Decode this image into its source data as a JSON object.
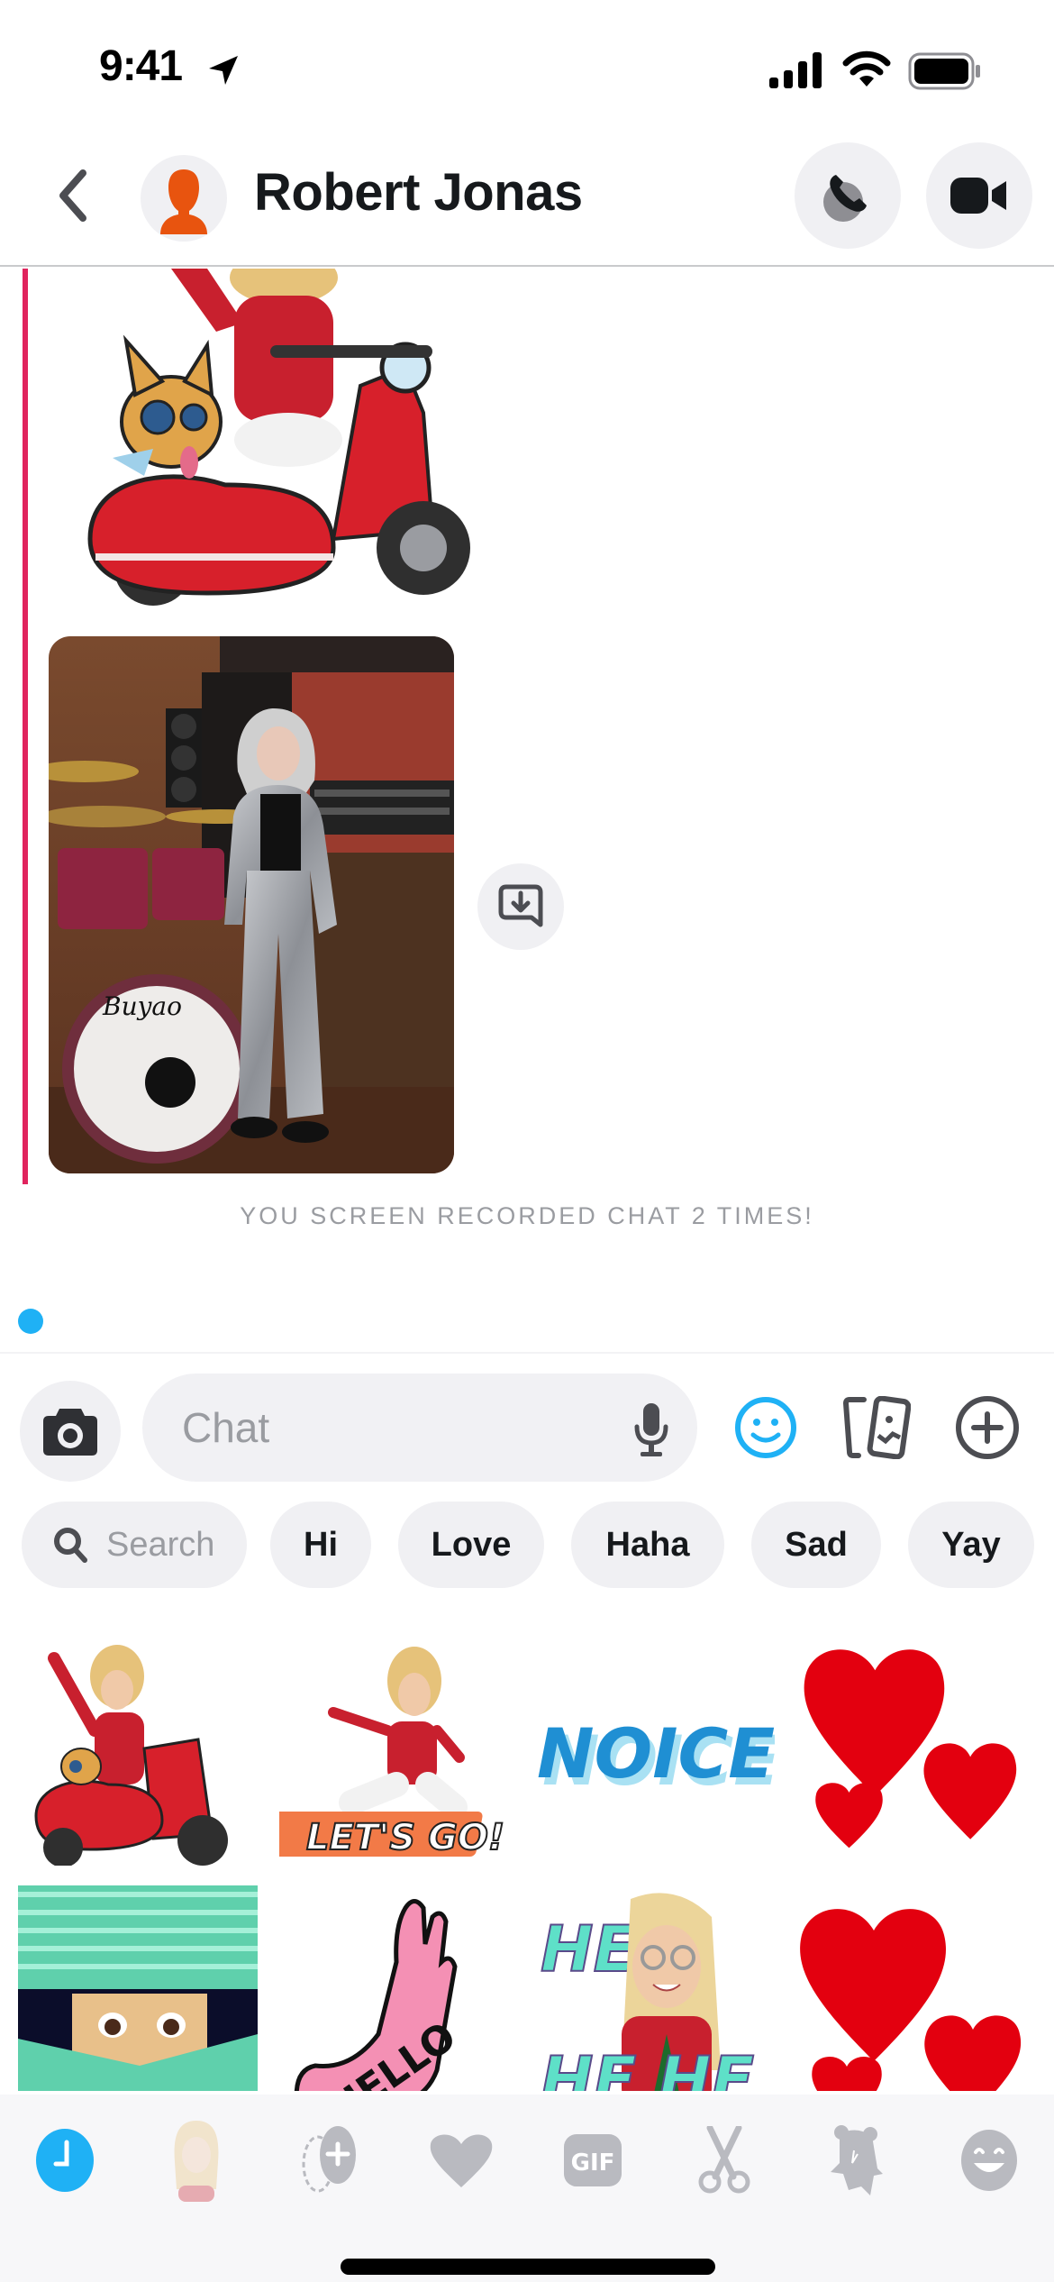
{
  "status_bar": {
    "time": "9:41"
  },
  "header": {
    "contact_name": "Robert Jonas",
    "back_label": "Back",
    "call_label": "Call",
    "video_label": "Video call"
  },
  "chat": {
    "messages": [
      {
        "type": "sticker",
        "description": "Bitmoji on red scooter with corgi in sidecar"
      },
      {
        "type": "photo",
        "description": "Woman in silver tracksuit standing by drum kit in recording studio"
      }
    ],
    "save_label": "Save in chat",
    "system_message": "YOU SCREEN RECORDED CHAT 2 TIMES!"
  },
  "input_bar": {
    "placeholder": "Chat",
    "value": ""
  },
  "chips": {
    "search_placeholder": "Search",
    "items": [
      "Hi",
      "Love",
      "Haha",
      "Sad",
      "Yay"
    ]
  },
  "stickers": [
    {
      "name": "scooter-bitmoji",
      "label": ""
    },
    {
      "name": "lets-go-bitmoji",
      "label": "LET'S GO!"
    },
    {
      "name": "noice",
      "label": "NOICE"
    },
    {
      "name": "hearts",
      "label": ""
    },
    {
      "name": "peeking-bitmoji",
      "label": ""
    },
    {
      "name": "hello-hand",
      "label": "HELLO"
    },
    {
      "name": "hehe-bitmoji",
      "label": "HE HE"
    },
    {
      "name": "hearts-2",
      "label": ""
    }
  ],
  "tab_bar": {
    "tabs": [
      {
        "name": "recent",
        "label": "Recent",
        "active": true
      },
      {
        "name": "bitmoji",
        "label": "Bitmoji",
        "active": false
      },
      {
        "name": "create",
        "label": "Create",
        "active": false
      },
      {
        "name": "favorites",
        "label": "Favorites",
        "active": false
      },
      {
        "name": "gif",
        "label": "GIF",
        "active": false
      },
      {
        "name": "cutouts",
        "label": "Cutouts",
        "active": false
      },
      {
        "name": "stickers",
        "label": "Stickers",
        "active": false
      },
      {
        "name": "emoji",
        "label": "Emoji",
        "active": false
      }
    ]
  },
  "colors": {
    "accent_blue": "#1fb1f5",
    "sender_bar": "#e0245e",
    "avatar_orange": "#e8540f",
    "icon_dark": "#4c4d52",
    "icon_gray": "#b9bac0",
    "chip_bg": "#f0f0f3"
  }
}
